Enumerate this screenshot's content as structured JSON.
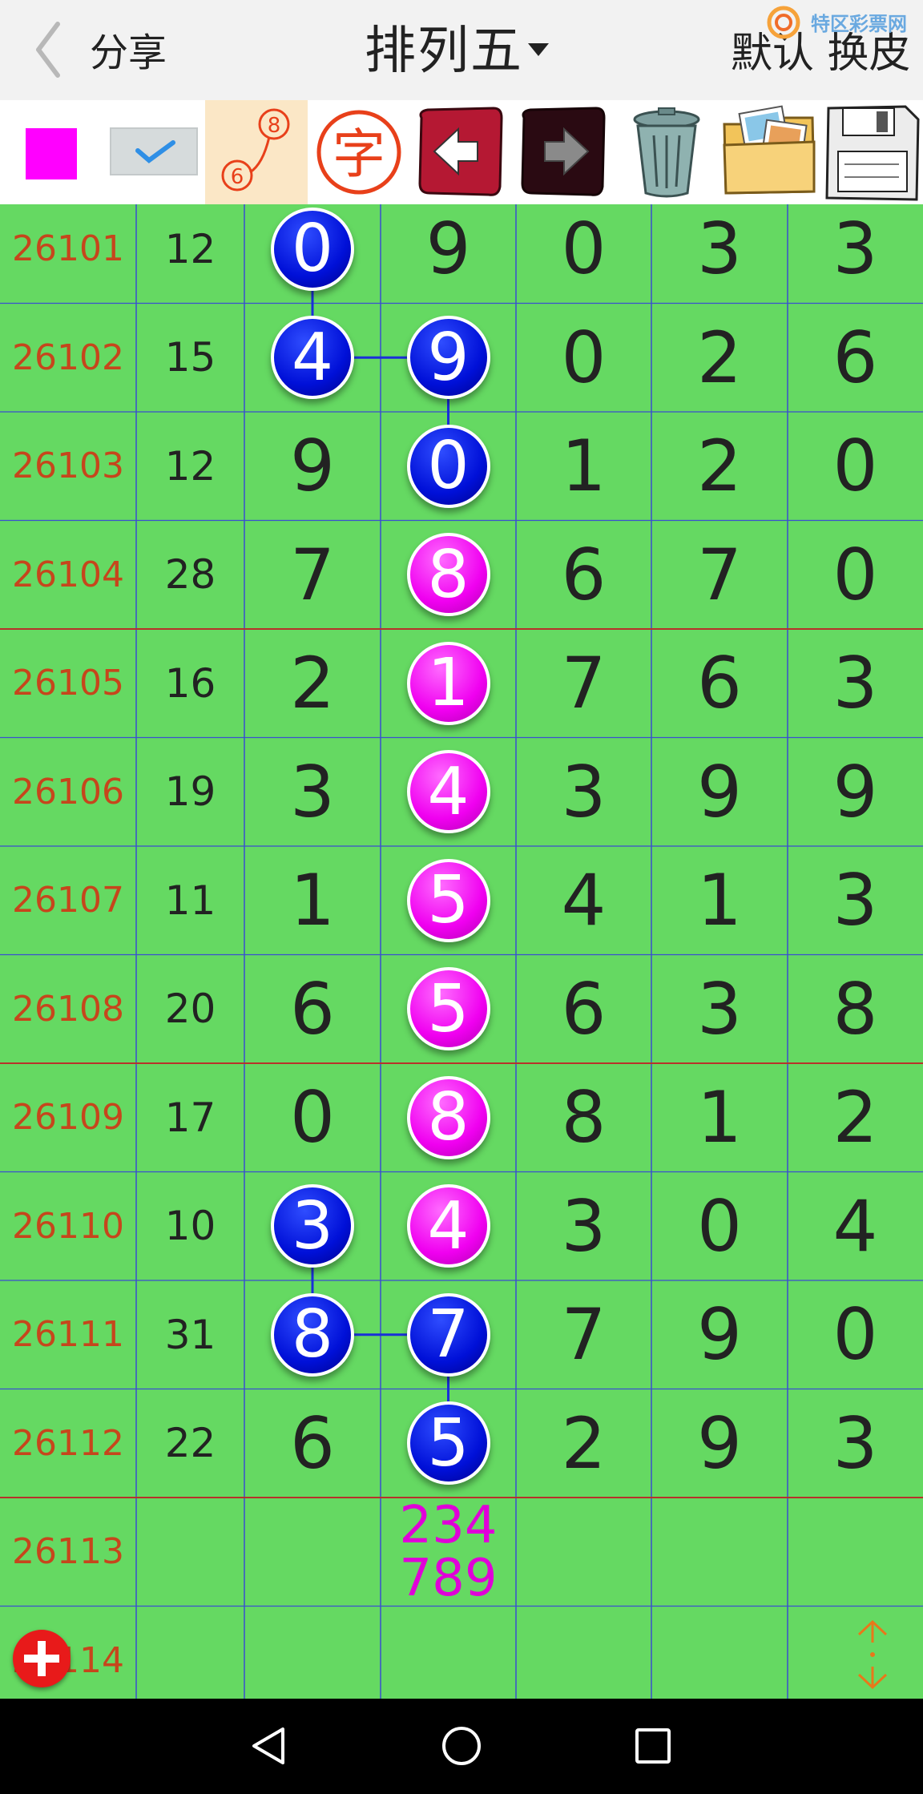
{
  "header": {
    "share_label": "分享",
    "title": "排列五",
    "skin_label": "默认 换皮",
    "watermark": "特区彩票网"
  },
  "toolbar": {
    "items": [
      {
        "name": "color-swatch",
        "color": "#ff00ff"
      },
      {
        "name": "check-toggle"
      },
      {
        "name": "link-mode",
        "num_a": "8",
        "num_b": "6"
      },
      {
        "name": "char-mode",
        "label": "字"
      },
      {
        "name": "undo"
      },
      {
        "name": "redo"
      },
      {
        "name": "trash"
      },
      {
        "name": "folder"
      },
      {
        "name": "save"
      }
    ]
  },
  "grid": {
    "colors": {
      "background": "#65d962",
      "issue": "#c6461c",
      "blue_ball": "#0010d8",
      "pink_ball": "#f000f0",
      "prediction": "#e000d8"
    },
    "rows": [
      {
        "issue": "26101",
        "sum": "12",
        "d": [
          "0",
          "9",
          "0",
          "3",
          "3"
        ]
      },
      {
        "issue": "26102",
        "sum": "15",
        "d": [
          "4",
          "9",
          "0",
          "2",
          "6"
        ]
      },
      {
        "issue": "26103",
        "sum": "12",
        "d": [
          "9",
          "0",
          "1",
          "2",
          "0"
        ]
      },
      {
        "issue": "26104",
        "sum": "28",
        "d": [
          "7",
          "8",
          "6",
          "7",
          "0"
        ]
      },
      {
        "issue": "26105",
        "sum": "16",
        "d": [
          "2",
          "1",
          "7",
          "6",
          "3"
        ]
      },
      {
        "issue": "26106",
        "sum": "19",
        "d": [
          "3",
          "4",
          "3",
          "9",
          "9"
        ]
      },
      {
        "issue": "26107",
        "sum": "11",
        "d": [
          "1",
          "5",
          "4",
          "1",
          "3"
        ]
      },
      {
        "issue": "26108",
        "sum": "20",
        "d": [
          "6",
          "5",
          "6",
          "3",
          "8"
        ]
      },
      {
        "issue": "26109",
        "sum": "17",
        "d": [
          "0",
          "8",
          "8",
          "1",
          "2"
        ]
      },
      {
        "issue": "26110",
        "sum": "10",
        "d": [
          "3",
          "4",
          "3",
          "0",
          "4"
        ]
      },
      {
        "issue": "26111",
        "sum": "31",
        "d": [
          "8",
          "7",
          "7",
          "9",
          "0"
        ]
      },
      {
        "issue": "26112",
        "sum": "22",
        "d": [
          "6",
          "5",
          "2",
          "9",
          "3"
        ]
      },
      {
        "issue": "26113",
        "sum": "",
        "d": [
          "",
          "",
          "",
          "",
          ""
        ]
      },
      {
        "issue": "26114",
        "sum": "",
        "d": [
          "",
          "",
          "",
          "",
          ""
        ]
      }
    ],
    "balls": [
      {
        "row": 0,
        "col": 0,
        "color": "blue"
      },
      {
        "row": 1,
        "col": 0,
        "color": "blue"
      },
      {
        "row": 1,
        "col": 1,
        "color": "blue"
      },
      {
        "row": 2,
        "col": 1,
        "color": "blue"
      },
      {
        "row": 3,
        "col": 1,
        "color": "pink"
      },
      {
        "row": 4,
        "col": 1,
        "color": "pink"
      },
      {
        "row": 5,
        "col": 1,
        "color": "pink"
      },
      {
        "row": 6,
        "col": 1,
        "color": "pink"
      },
      {
        "row": 7,
        "col": 1,
        "color": "pink"
      },
      {
        "row": 8,
        "col": 1,
        "color": "pink"
      },
      {
        "row": 9,
        "col": 1,
        "color": "pink"
      },
      {
        "row": 9,
        "col": 0,
        "color": "blue"
      },
      {
        "row": 10,
        "col": 0,
        "color": "blue"
      },
      {
        "row": 10,
        "col": 1,
        "color": "blue"
      },
      {
        "row": 11,
        "col": 1,
        "color": "blue"
      }
    ],
    "links": [
      [
        [
          0,
          0
        ],
        [
          1,
          0
        ]
      ],
      [
        [
          1,
          0
        ],
        [
          1,
          1
        ]
      ],
      [
        [
          1,
          1
        ],
        [
          2,
          1
        ]
      ],
      [
        [
          9,
          0
        ],
        [
          10,
          0
        ]
      ],
      [
        [
          10,
          0
        ],
        [
          10,
          1
        ]
      ],
      [
        [
          10,
          1
        ],
        [
          11,
          1
        ]
      ]
    ],
    "prediction": {
      "row": 12,
      "col": 1,
      "line1": "234",
      "line2": "789"
    }
  },
  "navbar": {
    "icons": [
      "back-triangle-icon",
      "home-circle-icon",
      "recents-square-icon"
    ]
  }
}
